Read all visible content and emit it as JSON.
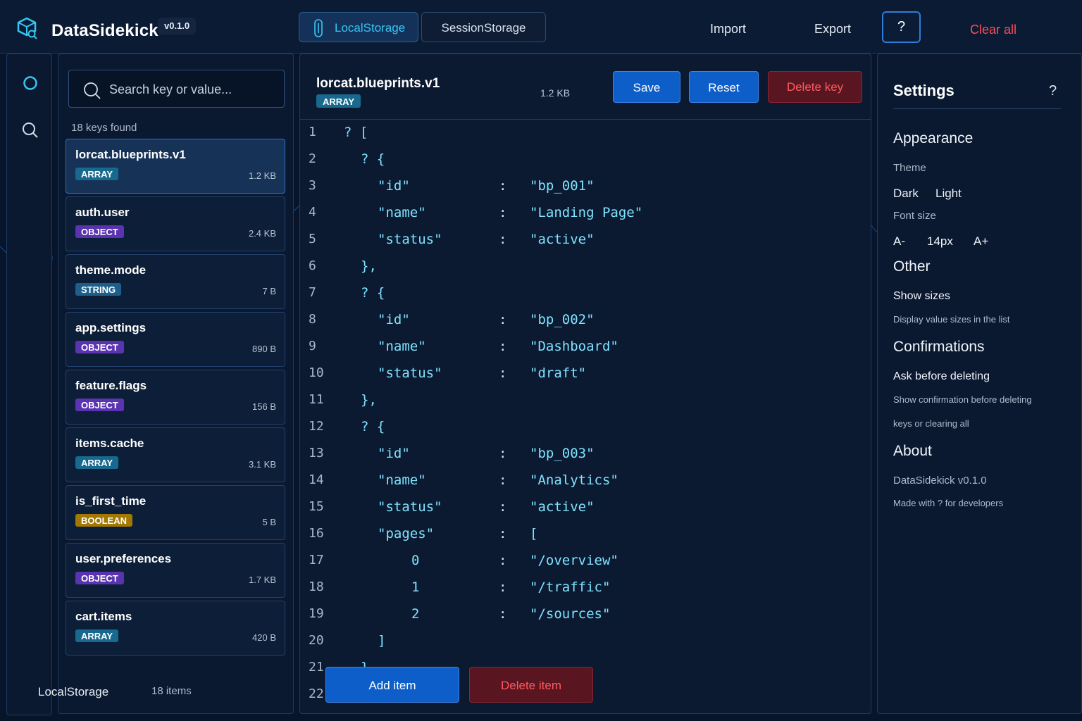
{
  "header": {
    "app_title": "DataSidekick",
    "version": "v0.1.0",
    "tabs": [
      {
        "label": "LocalStorage",
        "active": true
      },
      {
        "label": "SessionStorage",
        "active": false
      }
    ],
    "import_label": "Import",
    "export_label": "Export",
    "help_label": "?",
    "clear_all_label": "Clear all"
  },
  "sidebar": {
    "search_placeholder": "Search key or value...",
    "keys_count": "18 keys found",
    "items": [
      {
        "name": "lorcat.blueprints.v1",
        "type": "ARRAY",
        "size": "1.2 KB",
        "active": true
      },
      {
        "name": "auth.user",
        "type": "OBJECT",
        "size": "2.4 KB"
      },
      {
        "name": "theme.mode",
        "type": "STRING",
        "size": "7 B"
      },
      {
        "name": "app.settings",
        "type": "OBJECT",
        "size": "890 B"
      },
      {
        "name": "feature.flags",
        "type": "OBJECT",
        "size": "156 B"
      },
      {
        "name": "items.cache",
        "type": "ARRAY",
        "size": "3.1 KB"
      },
      {
        "name": "is_first_time",
        "type": "BOOLEAN",
        "size": "5 B"
      },
      {
        "name": "user.preferences",
        "type": "OBJECT",
        "size": "1.7 KB"
      },
      {
        "name": "cart.items",
        "type": "ARRAY",
        "size": "420 B"
      }
    ],
    "footer_storage": "LocalStorage",
    "footer_count": "18 items"
  },
  "editor": {
    "key": "lorcat.blueprints.v1",
    "type": "ARRAY",
    "size": "1.2 KB",
    "save_label": "Save",
    "reset_label": "Reset",
    "delete_key_label": "Delete key",
    "add_item_label": "Add item",
    "delete_item_label": "Delete item",
    "lines": [
      {
        "n": "1",
        "indent": 0,
        "text": "? ["
      },
      {
        "n": "2",
        "indent": 1,
        "text": "? {"
      },
      {
        "n": "3",
        "indent": 2,
        "key": "\"id\"",
        "val": "\"bp_001\""
      },
      {
        "n": "4",
        "indent": 2,
        "key": "\"name\"",
        "val": "\"Landing Page\""
      },
      {
        "n": "5",
        "indent": 2,
        "key": "\"status\"",
        "val": "\"active\""
      },
      {
        "n": "6",
        "indent": 1,
        "text": "},"
      },
      {
        "n": "7",
        "indent": 1,
        "text": "? {"
      },
      {
        "n": "8",
        "indent": 2,
        "key": "\"id\"",
        "val": "\"bp_002\""
      },
      {
        "n": "9",
        "indent": 2,
        "key": "\"name\"",
        "val": "\"Dashboard\""
      },
      {
        "n": "10",
        "indent": 2,
        "key": "\"status\"",
        "val": "\"draft\""
      },
      {
        "n": "11",
        "indent": 1,
        "text": "},"
      },
      {
        "n": "12",
        "indent": 1,
        "text": "? {"
      },
      {
        "n": "13",
        "indent": 2,
        "key": "\"id\"",
        "val": "\"bp_003\""
      },
      {
        "n": "14",
        "indent": 2,
        "key": "\"name\"",
        "val": "\"Analytics\""
      },
      {
        "n": "15",
        "indent": 2,
        "key": "\"status\"",
        "val": "\"active\""
      },
      {
        "n": "16",
        "indent": 2,
        "key": "\"pages\"",
        "val": "["
      },
      {
        "n": "17",
        "indent": 4,
        "key": "0",
        "val": "\"/overview\""
      },
      {
        "n": "18",
        "indent": 4,
        "key": "1",
        "val": "\"/traffic\""
      },
      {
        "n": "19",
        "indent": 4,
        "key": "2",
        "val": "\"/sources\""
      },
      {
        "n": "20",
        "indent": 2,
        "text": "]"
      },
      {
        "n": "21",
        "indent": 1,
        "text": "}"
      },
      {
        "n": "22",
        "indent": 0,
        "text": "]"
      }
    ]
  },
  "settings": {
    "title": "Settings",
    "help": "?",
    "appearance": "Appearance",
    "theme_label": "Theme",
    "theme_dark": "Dark",
    "theme_light": "Light",
    "font_size_label": "Font size",
    "font_dec": "A-",
    "font_value": "14px",
    "font_inc": "A+",
    "other": "Other",
    "show_sizes": "Show sizes",
    "show_sizes_desc": "Display value sizes in the list",
    "confirmations": "Confirmations",
    "ask_before_deleting": "Ask before deleting",
    "ask_desc_1": "Show confirmation before deleting",
    "ask_desc_2": "keys or clearing all",
    "about": "About",
    "about_version": "DataSidekick v0.1.0",
    "about_made": "Made with ? for developers"
  },
  "colors": {
    "background": "#07142a",
    "accent": "#0e5ec9",
    "danger": "#ff4d5a",
    "badge_array": "#176a8d",
    "badge_object": "#5a34b0",
    "badge_string": "#1d5f8a",
    "badge_boolean": "#a37800"
  }
}
